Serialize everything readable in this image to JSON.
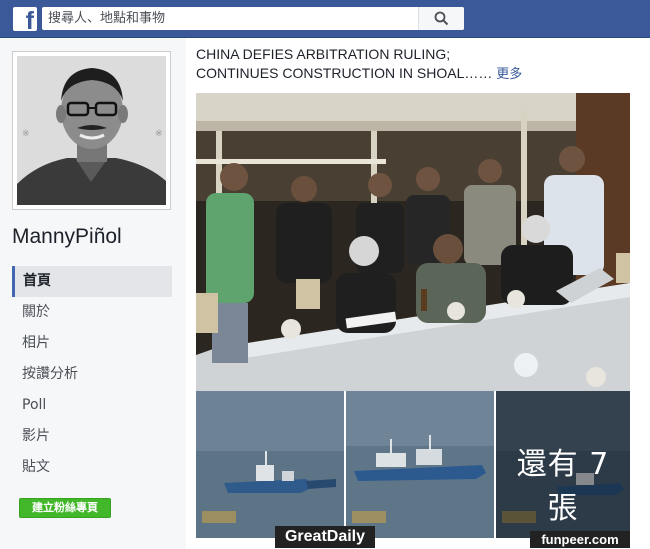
{
  "header": {
    "logo_letter": "f",
    "search_placeholder": "搜尋人、地點和事物"
  },
  "page": {
    "name": "MannyPiñol",
    "nav": [
      {
        "label": "首頁",
        "active": true
      },
      {
        "label": "關於",
        "active": false
      },
      {
        "label": "相片",
        "active": false
      },
      {
        "label": "按讚分析",
        "active": false
      },
      {
        "label": "Poll",
        "active": false
      },
      {
        "label": "影片",
        "active": false
      },
      {
        "label": "貼文",
        "active": false
      }
    ],
    "create_button": "建立粉絲專頁"
  },
  "post": {
    "line1": "CHINA DEFIES ARBITRATION RULING;",
    "line2": "CONTINUES CONSTRUCTION IN SHOAL",
    "ellipsis": "……",
    "more": "更多",
    "more_photos": "還有 7 張"
  },
  "watermarks": {
    "left": "GreatDaily",
    "right": "funpeer.com"
  },
  "colors": {
    "brand": "#3b5998",
    "link": "#365899",
    "create_button": "#42b72a"
  }
}
